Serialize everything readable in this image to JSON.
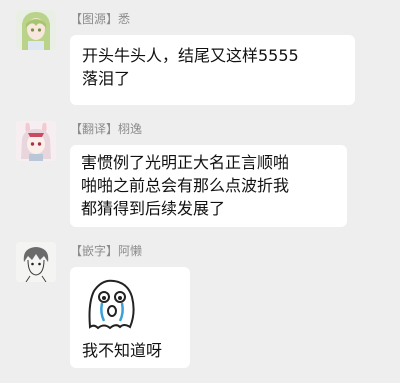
{
  "colors": {
    "background": "#eeeeee",
    "bubble": "#ffffff",
    "name_gray": "#8c8c8c",
    "text": "#111111"
  },
  "messages": [
    {
      "sender": "【图源】悉",
      "avatar_icon": "green-hair-anime-avatar",
      "text": "开头牛头人，结尾又这样5555\n落泪了"
    },
    {
      "sender": "【翻译】栩逸",
      "avatar_icon": "pink-bunny-anime-avatar",
      "text": "害惯例了光明正大名正言顺啪\n啪啪之前总会有那么点波折我\n都猜得到后续发展了"
    },
    {
      "sender": "【嵌字】阿懒",
      "avatar_icon": "sketch-anime-boy-avatar",
      "sticker_icon": "crying-ghost-sticker",
      "text": "我不知道呀"
    }
  ]
}
